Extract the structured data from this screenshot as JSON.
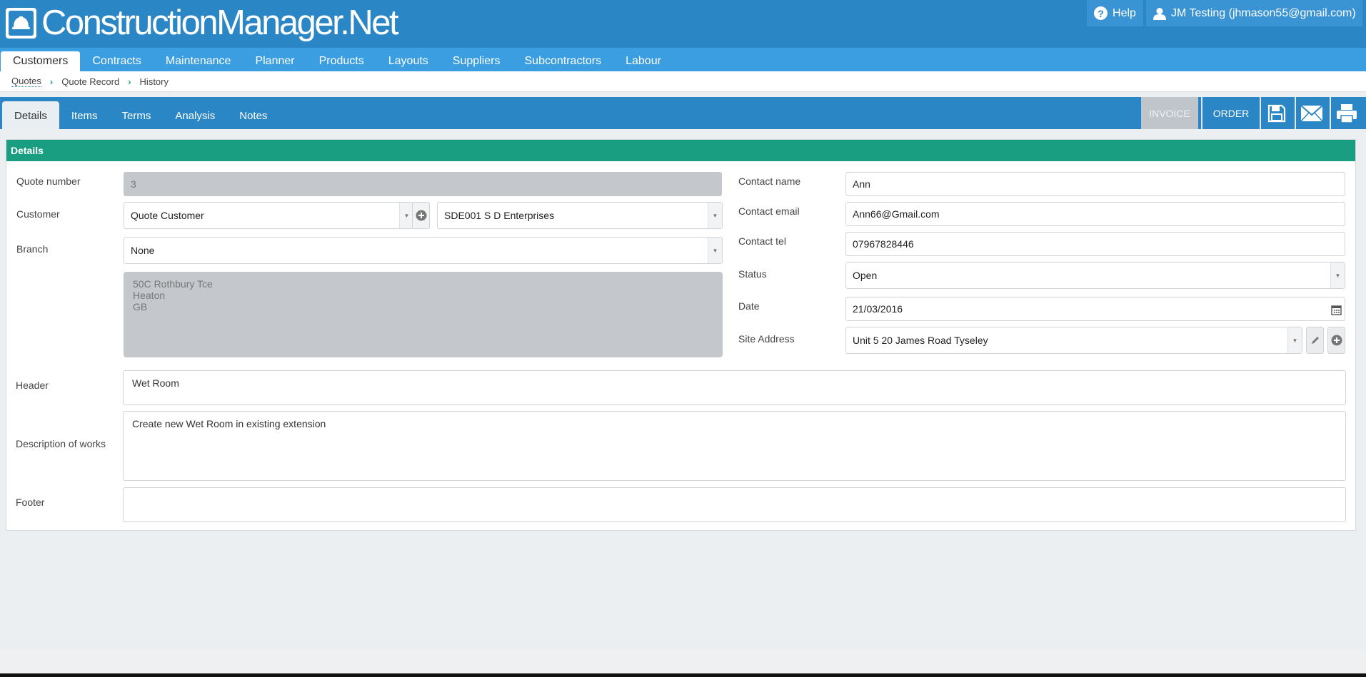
{
  "app": {
    "title": "ConstructionManager.Net",
    "help_label": "Help",
    "user_label": "JM Testing (jhmason55@gmail.com)"
  },
  "main_nav": [
    {
      "label": "Customers",
      "active": true
    },
    {
      "label": "Contracts"
    },
    {
      "label": "Maintenance"
    },
    {
      "label": "Planner"
    },
    {
      "label": "Products"
    },
    {
      "label": "Layouts"
    },
    {
      "label": "Suppliers"
    },
    {
      "label": "Subcontractors"
    },
    {
      "label": "Labour"
    }
  ],
  "breadcrumb": [
    "Quotes",
    "Quote Record",
    "History"
  ],
  "tabs": [
    {
      "label": "Details",
      "active": true
    },
    {
      "label": "Items"
    },
    {
      "label": "Terms"
    },
    {
      "label": "Analysis"
    },
    {
      "label": "Notes"
    }
  ],
  "toolbar": {
    "invoice_label": "INVOICE",
    "order_label": "ORDER",
    "icons": [
      "save-icon",
      "email-icon",
      "print-icon"
    ]
  },
  "panel": {
    "title": "Details"
  },
  "form": {
    "quote_number_label": "Quote number",
    "quote_number": "3",
    "customer_label": "Customer",
    "customer": "Quote Customer",
    "customer_account": "SDE001 S D Enterprises",
    "branch_label": "Branch",
    "branch": "None",
    "address_lines": [
      "50C Rothbury Tce",
      "Heaton",
      "GB"
    ],
    "contact_name_label": "Contact name",
    "contact_name": "Ann",
    "contact_email_label": "Contact email",
    "contact_email": "Ann66@Gmail.com",
    "contact_tel_label": "Contact tel",
    "contact_tel": "07967828446",
    "status_label": "Status",
    "status": "Open",
    "date_label": "Date",
    "date": "21/03/2016",
    "site_address_label": "Site Address",
    "site_address": "Unit 5 20 James Road Tyseley",
    "header_label": "Header",
    "header": "Wet Room",
    "description_label": "Description of works",
    "description": "Create new Wet Room in existing extension",
    "footer_label": "Footer",
    "footer": ""
  },
  "colors": {
    "header_blue": "#2b86c5",
    "nav_blue": "#3a9ee0",
    "panel_green": "#1a9e82"
  }
}
